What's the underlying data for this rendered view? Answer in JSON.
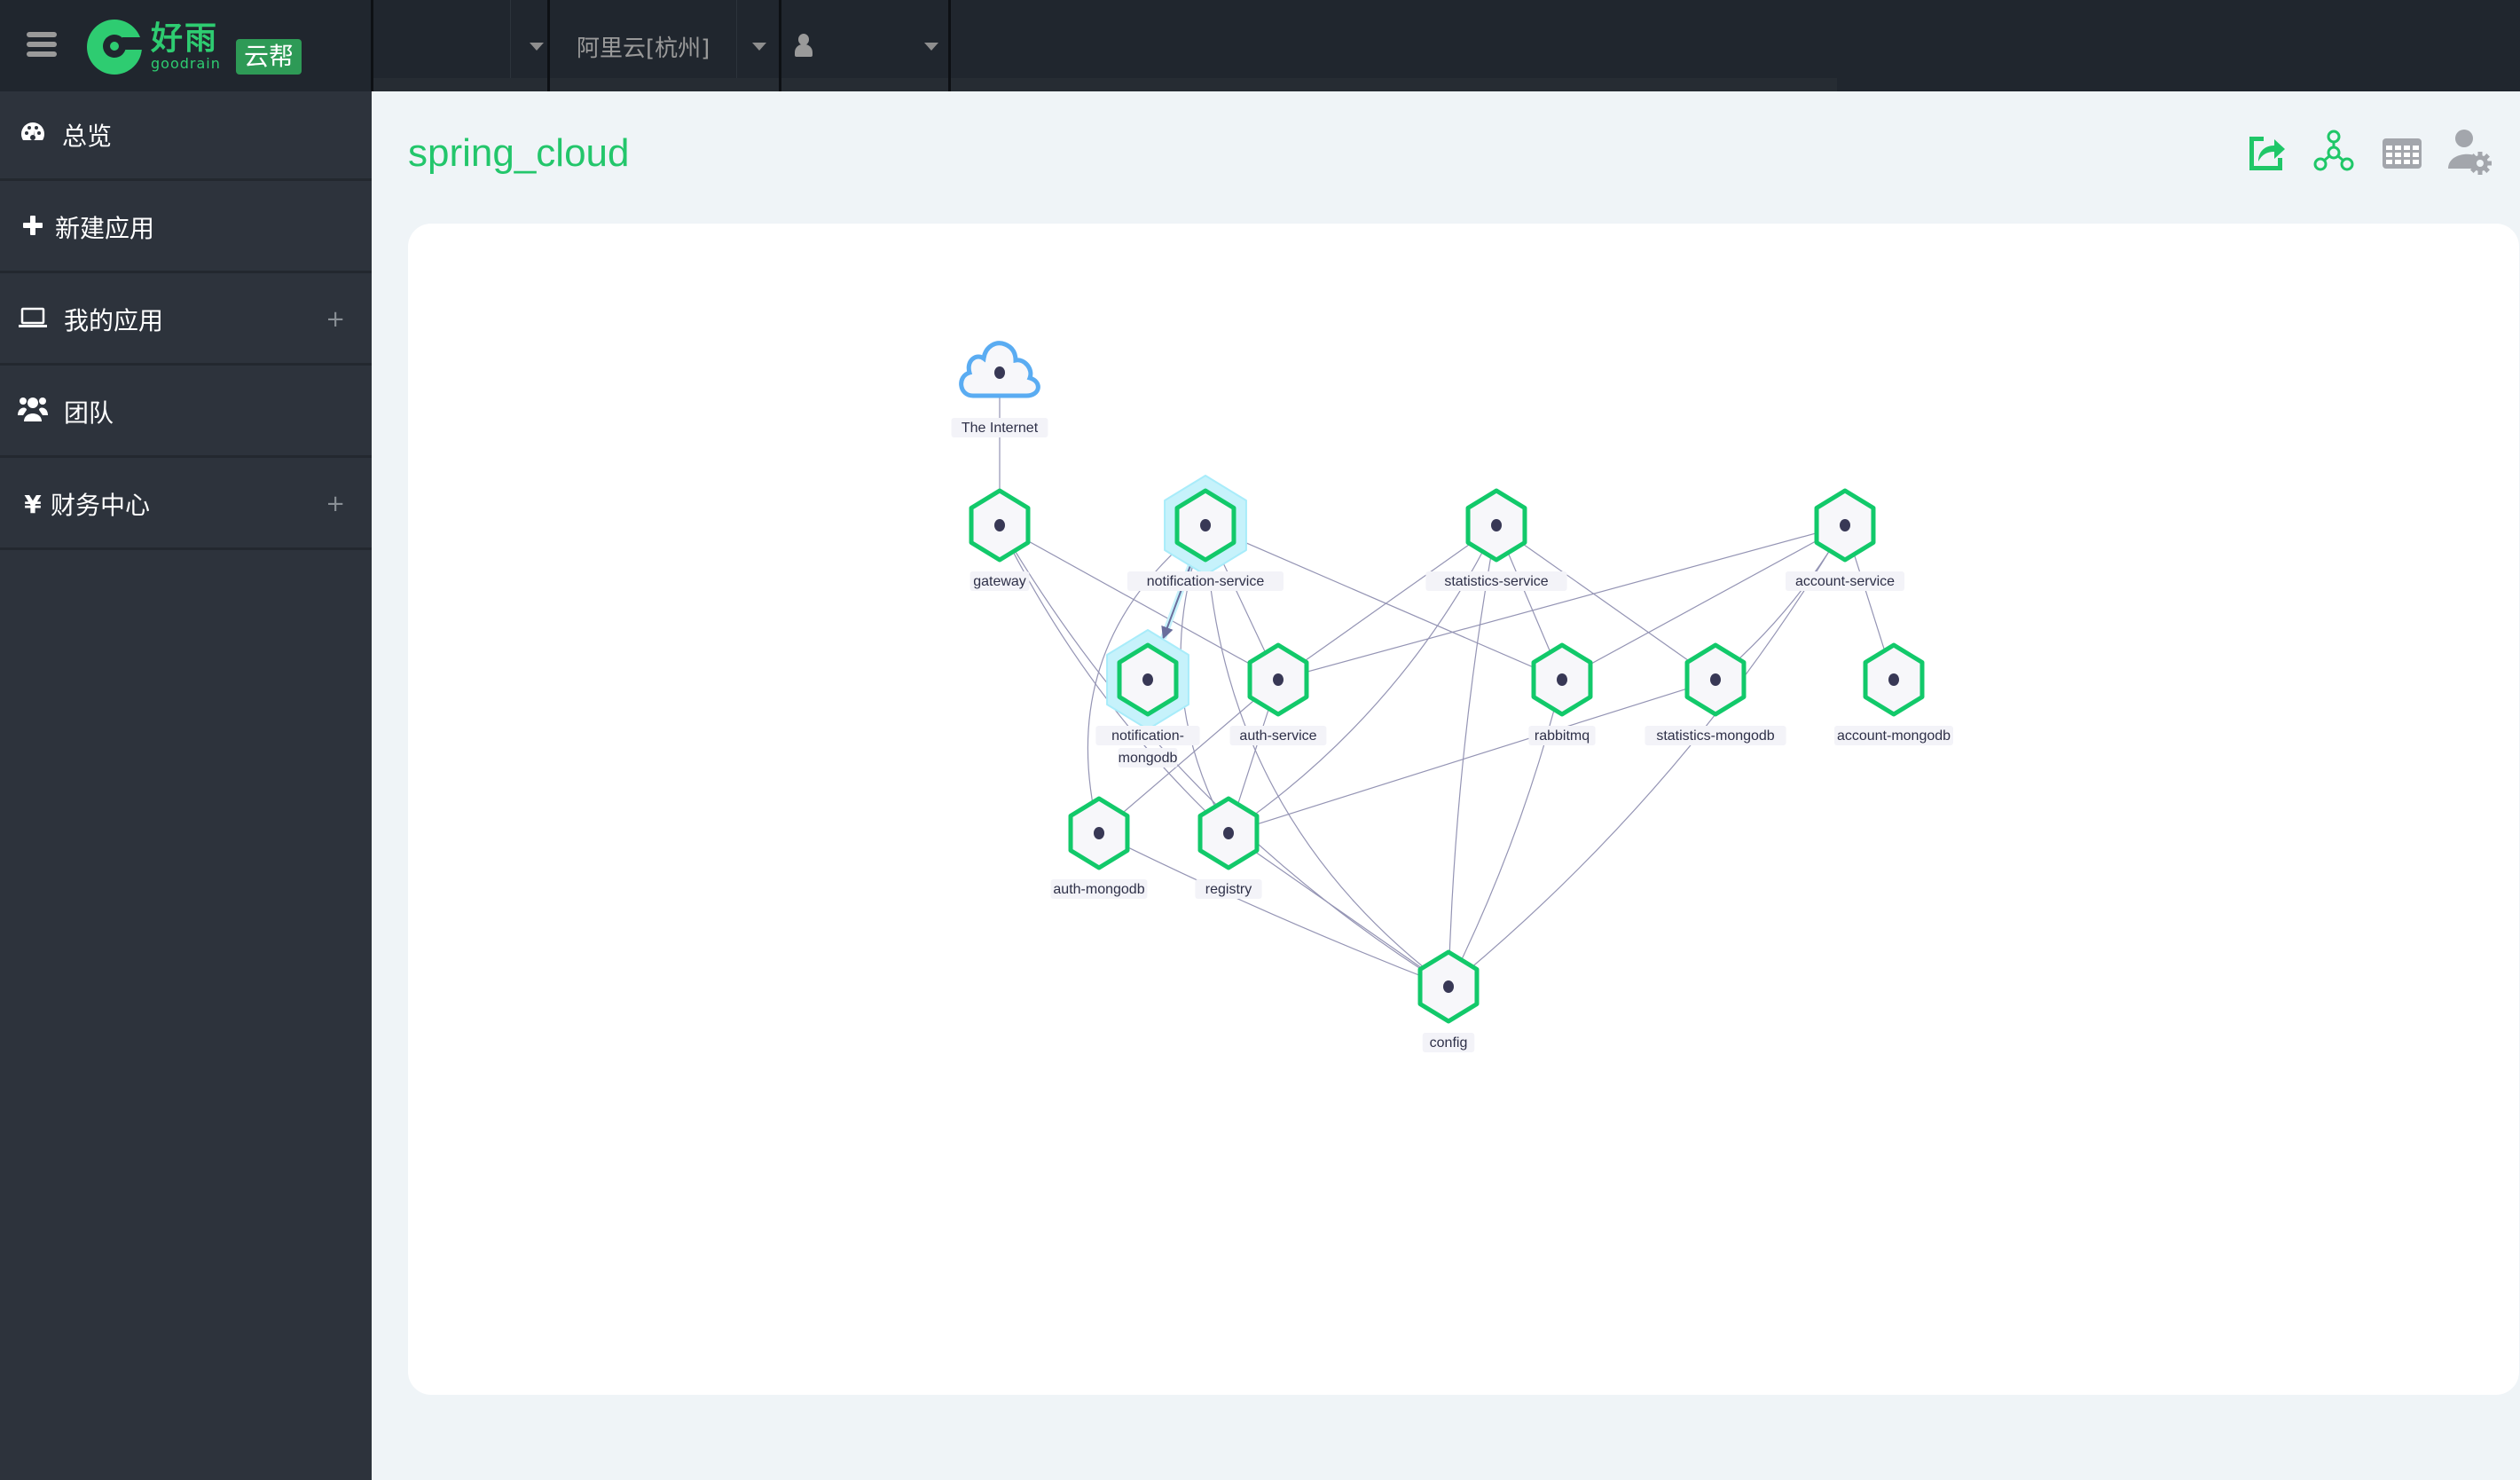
{
  "header": {
    "logo": {
      "name_cn": "好雨",
      "name_en": "goodrain",
      "badge": "云帮"
    },
    "team_dropdown": {
      "value": ""
    },
    "region_dropdown": {
      "value": "阿里云[杭州]"
    },
    "user_dropdown": {
      "value": ""
    }
  },
  "sidebar": {
    "items": [
      {
        "label": "总览",
        "icon": "dashboard-icon",
        "glyph": "◕",
        "expandable": false
      },
      {
        "label": "新建应用",
        "icon": "plus-icon",
        "glyph": "✚",
        "expandable": false
      },
      {
        "label": "我的应用",
        "icon": "laptop-icon",
        "glyph": "⌨",
        "expandable": true,
        "expand_glyph": "+"
      },
      {
        "label": "团队",
        "icon": "users-icon",
        "glyph": "👥",
        "expandable": false
      },
      {
        "label": "财务中心",
        "icon": "yen-icon",
        "glyph": "¥",
        "expandable": true,
        "expand_glyph": "+"
      }
    ]
  },
  "page": {
    "title": "spring_cloud",
    "toolbar": [
      {
        "name": "share-export-icon",
        "color": "#1fc768"
      },
      {
        "name": "topology-icon",
        "color": "#1fc768"
      },
      {
        "name": "table-grid-icon",
        "color": "#a3a6ac"
      },
      {
        "name": "user-settings-icon",
        "color": "#a3a6ac"
      }
    ]
  },
  "colors": {
    "accent": "#23c66b",
    "node_stroke": "#12c96a",
    "internet_stroke": "#5aacf2",
    "highlight_glow": "#c6f2fb"
  },
  "topology": {
    "nodes": [
      {
        "id": "internet",
        "label": "The Internet",
        "type": "cloud"
      },
      {
        "id": "gateway",
        "label": "gateway",
        "type": "service"
      },
      {
        "id": "notification-service",
        "label": "notification-service",
        "type": "service",
        "highlighted": true
      },
      {
        "id": "statistics-service",
        "label": "statistics-service",
        "type": "service"
      },
      {
        "id": "account-service",
        "label": "account-service",
        "type": "service"
      },
      {
        "id": "notification-mongodb",
        "label": "notification-mongodb",
        "label_lines": [
          "notification-",
          "mongodb"
        ],
        "type": "service",
        "highlighted": true
      },
      {
        "id": "auth-service",
        "label": "auth-service",
        "type": "service"
      },
      {
        "id": "rabbitmq",
        "label": "rabbitmq",
        "type": "service"
      },
      {
        "id": "statistics-mongodb",
        "label": "statistics-mongodb",
        "type": "service"
      },
      {
        "id": "account-mongodb",
        "label": "account-mongodb",
        "type": "service"
      },
      {
        "id": "auth-mongodb",
        "label": "auth-mongodb",
        "type": "service"
      },
      {
        "id": "registry",
        "label": "registry",
        "type": "service"
      },
      {
        "id": "config",
        "label": "config",
        "type": "service"
      }
    ],
    "edges": [
      {
        "from": "internet",
        "to": "gateway"
      },
      {
        "from": "gateway",
        "to": "auth-service"
      },
      {
        "from": "gateway",
        "to": "registry"
      },
      {
        "from": "gateway",
        "to": "config"
      },
      {
        "from": "notification-service",
        "to": "notification-mongodb",
        "highlighted": true,
        "arrow": true
      },
      {
        "from": "notification-service",
        "to": "auth-service"
      },
      {
        "from": "notification-service",
        "to": "rabbitmq"
      },
      {
        "from": "notification-service",
        "to": "registry"
      },
      {
        "from": "notification-service",
        "to": "auth-mongodb"
      },
      {
        "from": "notification-service",
        "to": "config"
      },
      {
        "from": "statistics-service",
        "to": "auth-service"
      },
      {
        "from": "statistics-service",
        "to": "rabbitmq"
      },
      {
        "from": "statistics-service",
        "to": "statistics-mongodb"
      },
      {
        "from": "statistics-service",
        "to": "registry"
      },
      {
        "from": "statistics-service",
        "to": "config"
      },
      {
        "from": "account-service",
        "to": "auth-service"
      },
      {
        "from": "account-service",
        "to": "rabbitmq"
      },
      {
        "from": "account-service",
        "to": "account-mongodb"
      },
      {
        "from": "account-service",
        "to": "statistics-mongodb"
      },
      {
        "from": "account-service",
        "to": "config"
      },
      {
        "from": "auth-service",
        "to": "auth-mongodb"
      },
      {
        "from": "auth-service",
        "to": "registry"
      },
      {
        "from": "statistics-mongodb",
        "to": "registry"
      },
      {
        "from": "auth-mongodb",
        "to": "config"
      },
      {
        "from": "registry",
        "to": "config"
      },
      {
        "from": "rabbitmq",
        "to": "config"
      }
    ]
  }
}
